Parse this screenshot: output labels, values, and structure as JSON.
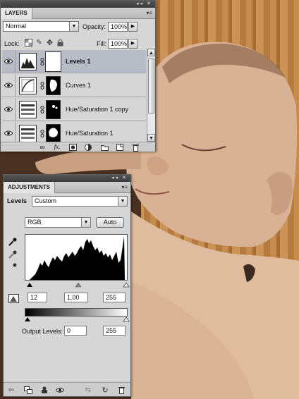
{
  "layers_panel": {
    "tab_label": "LAYERS",
    "blend_mode": "Normal",
    "opacity_label": "Opacity:",
    "opacity_value": "100%",
    "lock_label": "Lock:",
    "fill_label": "Fill:",
    "fill_value": "100%",
    "layers": [
      {
        "name": "Levels 1",
        "selected": true
      },
      {
        "name": "Curves 1",
        "selected": false
      },
      {
        "name": "Hue/Saturation 1 copy",
        "selected": false
      },
      {
        "name": "Hue/Saturation 1",
        "selected": false
      }
    ]
  },
  "adjustments_panel": {
    "tab_label": "ADJUSTMENTS",
    "adjustment_name": "Levels",
    "preset": "Custom",
    "channel": "RGB",
    "auto_label": "Auto",
    "input_black": "12",
    "input_gamma": "1.00",
    "input_white": "255",
    "output_label": "Output Levels:",
    "output_black": "0",
    "output_white": "255"
  },
  "colors": {
    "panel_bg": "#d6d6d6",
    "titlebar": "#444444",
    "selected_row": "#b7bcc7"
  }
}
